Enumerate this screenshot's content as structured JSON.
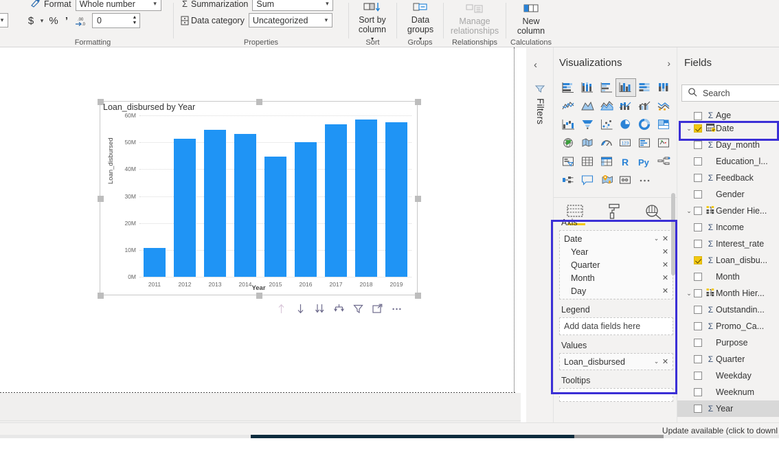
{
  "ribbon": {
    "formatting": {
      "group_label": "Formatting",
      "format_label": "Format",
      "format_value": "Whole number",
      "currency_icon": "currency-dollar-icon",
      "percent_icon": "percent-icon",
      "thousands_icon": "thousands-separator-icon",
      "decimal_icon": "decrease-decimal-icon",
      "decimal_places_value": "0"
    },
    "properties": {
      "group_label": "Properties",
      "summarization_label": "Summarization",
      "summarization_value": "Sum",
      "data_category_label": "Data category",
      "data_category_value": "Uncategorized"
    },
    "sort": {
      "group_label": "Sort",
      "button_label": "Sort by column"
    },
    "groups": {
      "group_label": "Groups",
      "button_label": "Data groups"
    },
    "relationships": {
      "group_label": "Relationships",
      "button_label": "Manage relationships"
    },
    "calculations": {
      "group_label": "Calculations",
      "button_label": "New column"
    }
  },
  "chart_data": {
    "type": "bar",
    "title": "Loan_disbursed by Year",
    "xlabel": "Year",
    "ylabel": "Loan_disbursed",
    "categories": [
      "2011",
      "2012",
      "2013",
      "2014",
      "2015",
      "2016",
      "2017",
      "2018",
      "2019"
    ],
    "values": [
      10700000,
      51200000,
      54600000,
      53000000,
      44700000,
      50100000,
      56700000,
      58400000,
      57500000
    ],
    "ylim": [
      0,
      60000000
    ],
    "ytick_labels": [
      "60M",
      "50M",
      "40M",
      "30M",
      "20M",
      "10M",
      "0M"
    ],
    "ytick_values": [
      60000000,
      50000000,
      40000000,
      30000000,
      20000000,
      10000000,
      0
    ],
    "bar_color": "#1f94f5",
    "grid": true,
    "legend": "none"
  },
  "visual_toolbar": {
    "icons": [
      {
        "name": "drill-up-icon",
        "glyph": "↑",
        "disabled": true
      },
      {
        "name": "drill-down-icon",
        "glyph": "↓",
        "disabled": false
      },
      {
        "name": "expand-all-down-icon",
        "glyph": "⇊",
        "disabled": false
      },
      {
        "name": "hierarchy-drill-icon",
        "glyph": "⊓",
        "disabled": false
      },
      {
        "name": "filter-icon",
        "glyph": "∇",
        "disabled": false
      },
      {
        "name": "focus-mode-icon",
        "glyph": "↗",
        "disabled": false
      },
      {
        "name": "more-options-icon",
        "glyph": "⋯",
        "disabled": false
      }
    ]
  },
  "filters_pane": {
    "collapse_chevron": "‹",
    "filter_icon": "filter-funnel-icon",
    "title": "Filters"
  },
  "visualizations": {
    "title": "Visualizations",
    "expand_chevron": "›",
    "icons": [
      "stacked-bar-chart-icon",
      "stacked-column-chart-icon",
      "clustered-bar-chart-icon",
      "clustered-column-chart-icon",
      "100-percent-stacked-bar-icon",
      "100-percent-stacked-column-icon",
      "line-chart-icon",
      "area-chart-icon",
      "stacked-area-chart-icon",
      "line-and-stacked-column-icon",
      "line-and-clustered-column-icon",
      "ribbon-chart-icon",
      "waterfall-chart-icon",
      "funnel-chart-icon",
      "scatter-chart-icon",
      "pie-chart-icon",
      "donut-chart-icon",
      "treemap-icon",
      "map-icon",
      "filled-map-icon",
      "gauge-icon",
      "card-icon",
      "multi-row-card-icon",
      "kpi-icon",
      "slicer-icon",
      "table-icon",
      "matrix-icon",
      "r-script-visual-icon",
      "python-visual-icon",
      "decomposition-tree-icon",
      "key-influencers-icon",
      "q-and-a-icon",
      "arcgis-map-icon",
      "paginated-report-icon",
      "get-more-visuals-icon"
    ],
    "selected_icon_index": 3,
    "tabs": [
      {
        "name": "fields-tab",
        "icon": "fields-table-icon",
        "active": true
      },
      {
        "name": "format-tab",
        "icon": "paint-roller-icon",
        "active": false
      },
      {
        "name": "analytics-tab",
        "icon": "analytics-magnifier-icon",
        "active": false
      }
    ],
    "wells": [
      {
        "label": "Axis",
        "placeholder": null,
        "items": [
          {
            "text": "Date",
            "level": 0,
            "has_caret": true,
            "has_remove": true
          },
          {
            "text": "Year",
            "level": 1,
            "has_caret": false,
            "has_remove": true
          },
          {
            "text": "Quarter",
            "level": 1,
            "has_caret": false,
            "has_remove": true
          },
          {
            "text": "Month",
            "level": 1,
            "has_caret": false,
            "has_remove": true
          },
          {
            "text": "Day",
            "level": 1,
            "has_caret": false,
            "has_remove": true
          }
        ]
      },
      {
        "label": "Legend",
        "placeholder": "Add data fields here",
        "items": []
      },
      {
        "label": "Values",
        "placeholder": null,
        "items": [
          {
            "text": "Loan_disbursed",
            "level": 0,
            "has_caret": true,
            "has_remove": true
          }
        ]
      },
      {
        "label": "Tooltips",
        "placeholder": "",
        "items": []
      }
    ]
  },
  "fields": {
    "title": "Fields",
    "search_placeholder": "Search",
    "search_icon": "search-magnifier-icon",
    "items": [
      {
        "name": "Age",
        "checked": false,
        "sigma": true,
        "chevron": false,
        "icon": null,
        "highlight": false,
        "clipped_top": true
      },
      {
        "name": "Date",
        "checked": true,
        "sigma": false,
        "chevron": true,
        "icon": "calendar-date-table-icon",
        "highlight": false,
        "outlined": true
      },
      {
        "name": "Day_month",
        "checked": false,
        "sigma": true,
        "chevron": false,
        "icon": null,
        "highlight": false
      },
      {
        "name": "Education_l...",
        "checked": false,
        "sigma": false,
        "chevron": false,
        "icon": null,
        "highlight": false
      },
      {
        "name": "Feedback",
        "checked": false,
        "sigma": true,
        "chevron": false,
        "icon": null,
        "highlight": false
      },
      {
        "name": "Gender",
        "checked": false,
        "sigma": false,
        "chevron": false,
        "icon": null,
        "highlight": false
      },
      {
        "name": "Gender Hie...",
        "checked": false,
        "sigma": false,
        "chevron": true,
        "icon": "hierarchy-icon",
        "highlight": false
      },
      {
        "name": "Income",
        "checked": false,
        "sigma": true,
        "chevron": false,
        "icon": null,
        "highlight": false
      },
      {
        "name": "Interest_rate",
        "checked": false,
        "sigma": true,
        "chevron": false,
        "icon": null,
        "highlight": false
      },
      {
        "name": "Loan_disbu...",
        "checked": true,
        "sigma": true,
        "chevron": false,
        "icon": null,
        "highlight": false
      },
      {
        "name": "Month",
        "checked": false,
        "sigma": false,
        "chevron": false,
        "icon": null,
        "highlight": false
      },
      {
        "name": "Month Hier...",
        "checked": false,
        "sigma": false,
        "chevron": true,
        "icon": "hierarchy-icon",
        "highlight": false
      },
      {
        "name": "Outstandin...",
        "checked": false,
        "sigma": true,
        "chevron": false,
        "icon": null,
        "highlight": false
      },
      {
        "name": "Promo_Ca...",
        "checked": false,
        "sigma": true,
        "chevron": false,
        "icon": null,
        "highlight": false
      },
      {
        "name": "Purpose",
        "checked": false,
        "sigma": false,
        "chevron": false,
        "icon": null,
        "highlight": false
      },
      {
        "name": "Quarter",
        "checked": false,
        "sigma": true,
        "chevron": false,
        "icon": null,
        "highlight": false
      },
      {
        "name": "Weekday",
        "checked": false,
        "sigma": false,
        "chevron": false,
        "icon": null,
        "highlight": false
      },
      {
        "name": "Weeknum",
        "checked": false,
        "sigma": false,
        "chevron": false,
        "icon": null,
        "highlight": false
      },
      {
        "name": "Year",
        "checked": false,
        "sigma": true,
        "chevron": false,
        "icon": null,
        "highlight": true
      }
    ]
  },
  "status_bar": {
    "update_message": "Update available (click to downl"
  },
  "colors": {
    "accent_blue": "#1f94f5",
    "highlight_purple": "#3b2fd6",
    "yellow_check": "#f2c811",
    "pane_bg": "#f3f2f1"
  }
}
